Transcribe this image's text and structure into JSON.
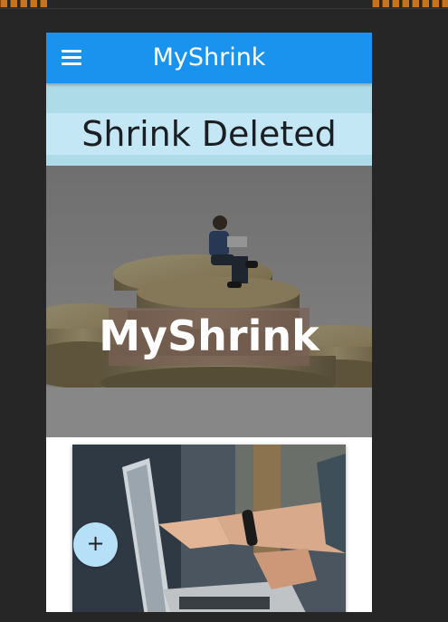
{
  "app": {
    "title": "MyShrink"
  },
  "alert": {
    "message": "Shrink Deleted"
  },
  "hero": {
    "label": "MyShrink"
  },
  "fab": {
    "label": "+"
  },
  "colors": {
    "appbar": "#1a93ee",
    "alert_bg": "#c3e7f4",
    "fab": "#b6e0f7"
  },
  "icons": {
    "menu": "menu-icon",
    "add": "plus-icon"
  }
}
